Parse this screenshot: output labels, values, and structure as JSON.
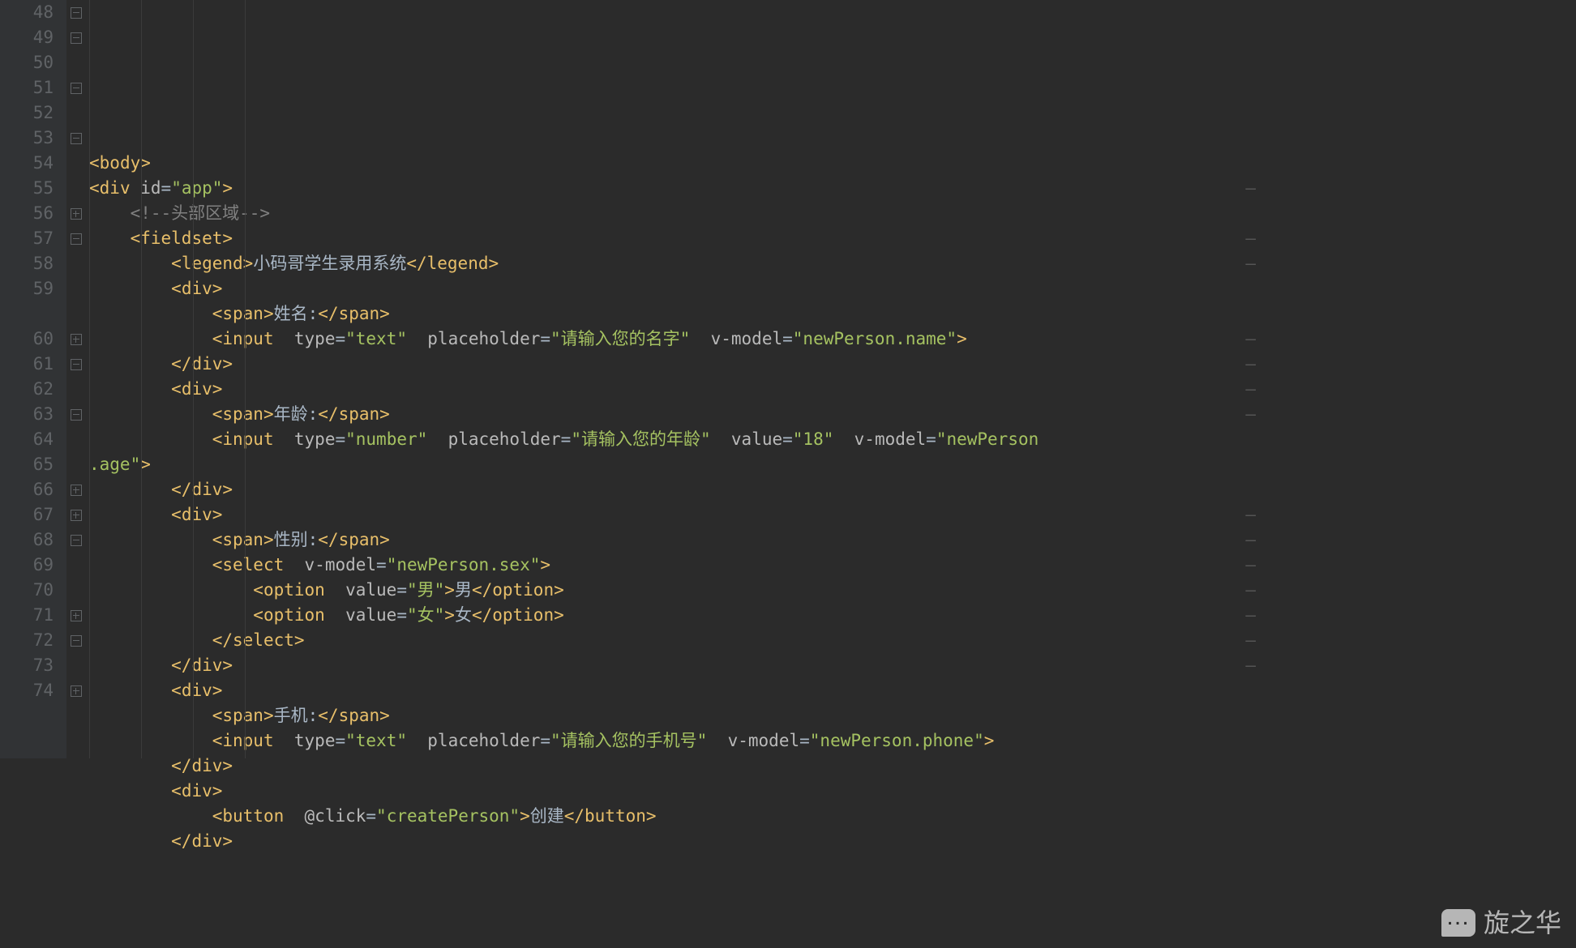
{
  "gutter": {
    "start": 48,
    "numbers": [
      "48",
      "49",
      "50",
      "51",
      "52",
      "53",
      "54",
      "55",
      "56",
      "57",
      "58",
      "59",
      "",
      "60",
      "61",
      "62",
      "63",
      "64",
      "65",
      "66",
      "67",
      "68",
      "69",
      "70",
      "71",
      "72",
      "73",
      "74"
    ]
  },
  "fold": [
    "open",
    "open",
    "blank",
    "open",
    "blank",
    "open",
    "blank",
    "blank",
    "close",
    "open",
    "blank",
    "blank",
    "blank",
    "close",
    "open",
    "blank",
    "open",
    "blank",
    "blank",
    "close",
    "close",
    "open",
    "blank",
    "blank",
    "close",
    "open",
    "blank",
    "close"
  ],
  "rows": [
    {
      "indent": 0,
      "parts": [
        {
          "t": "ang",
          "v": "<"
        },
        {
          "t": "tag",
          "v": "body"
        },
        {
          "t": "ang",
          "v": ">"
        }
      ]
    },
    {
      "indent": 0,
      "parts": [
        {
          "t": "ang",
          "v": "<"
        },
        {
          "t": "tag",
          "v": "div"
        },
        {
          "t": "txt",
          "v": " "
        },
        {
          "t": "attr",
          "v": "id"
        },
        {
          "t": "eq",
          "v": "="
        },
        {
          "t": "str",
          "v": "\"app\""
        },
        {
          "t": "ang",
          "v": ">"
        }
      ]
    },
    {
      "indent": 1,
      "parts": [
        {
          "t": "cmt",
          "v": "<!--头部区域-->"
        }
      ]
    },
    {
      "indent": 1,
      "parts": [
        {
          "t": "ang",
          "v": "<"
        },
        {
          "t": "tag",
          "v": "fieldset"
        },
        {
          "t": "ang",
          "v": ">"
        }
      ]
    },
    {
      "indent": 2,
      "parts": [
        {
          "t": "ang",
          "v": "<"
        },
        {
          "t": "tag",
          "v": "legend"
        },
        {
          "t": "ang",
          "v": ">"
        },
        {
          "t": "txt",
          "v": "小码哥学生录用系统"
        },
        {
          "t": "ang",
          "v": "</"
        },
        {
          "t": "tag",
          "v": "legend"
        },
        {
          "t": "ang",
          "v": ">"
        }
      ]
    },
    {
      "indent": 2,
      "parts": [
        {
          "t": "ang",
          "v": "<"
        },
        {
          "t": "tag",
          "v": "div"
        },
        {
          "t": "ang",
          "v": ">"
        }
      ]
    },
    {
      "indent": 3,
      "parts": [
        {
          "t": "ang",
          "v": "<"
        },
        {
          "t": "tag",
          "v": "span"
        },
        {
          "t": "ang",
          "v": ">"
        },
        {
          "t": "txt",
          "v": "姓名:"
        },
        {
          "t": "ang",
          "v": "</"
        },
        {
          "t": "tag",
          "v": "span"
        },
        {
          "t": "ang",
          "v": ">"
        }
      ]
    },
    {
      "indent": 3,
      "parts": [
        {
          "t": "ang",
          "v": "<"
        },
        {
          "t": "tag",
          "v": "input"
        },
        {
          "t": "txt",
          "v": "  "
        },
        {
          "t": "attr",
          "v": "type"
        },
        {
          "t": "eq",
          "v": "="
        },
        {
          "t": "str",
          "v": "\"text\""
        },
        {
          "t": "txt",
          "v": "  "
        },
        {
          "t": "attr",
          "v": "placeholder"
        },
        {
          "t": "eq",
          "v": "="
        },
        {
          "t": "str",
          "v": "\"请输入您的名字\""
        },
        {
          "t": "txt",
          "v": "  "
        },
        {
          "t": "attr",
          "v": "v-model"
        },
        {
          "t": "eq",
          "v": "="
        },
        {
          "t": "str",
          "v": "\"newPerson.name\""
        },
        {
          "t": "ang",
          "v": ">"
        }
      ]
    },
    {
      "indent": 2,
      "parts": [
        {
          "t": "ang",
          "v": "</"
        },
        {
          "t": "tag",
          "v": "div"
        },
        {
          "t": "ang",
          "v": ">"
        }
      ]
    },
    {
      "indent": 2,
      "parts": [
        {
          "t": "ang",
          "v": "<"
        },
        {
          "t": "tag",
          "v": "div"
        },
        {
          "t": "ang",
          "v": ">"
        }
      ]
    },
    {
      "indent": 3,
      "parts": [
        {
          "t": "ang",
          "v": "<"
        },
        {
          "t": "tag",
          "v": "span"
        },
        {
          "t": "ang",
          "v": ">"
        },
        {
          "t": "txt",
          "v": "年龄:"
        },
        {
          "t": "ang",
          "v": "</"
        },
        {
          "t": "tag",
          "v": "span"
        },
        {
          "t": "ang",
          "v": ">"
        }
      ]
    },
    {
      "indent": 3,
      "wrap": true,
      "parts": [
        {
          "t": "ang",
          "v": "<"
        },
        {
          "t": "tag",
          "v": "input"
        },
        {
          "t": "txt",
          "v": "  "
        },
        {
          "t": "attr",
          "v": "type"
        },
        {
          "t": "eq",
          "v": "="
        },
        {
          "t": "str",
          "v": "\"number\""
        },
        {
          "t": "txt",
          "v": "  "
        },
        {
          "t": "attr",
          "v": "placeholder"
        },
        {
          "t": "eq",
          "v": "="
        },
        {
          "t": "str",
          "v": "\"请输入您的年龄\""
        },
        {
          "t": "txt",
          "v": "  "
        },
        {
          "t": "attr",
          "v": "value"
        },
        {
          "t": "eq",
          "v": "="
        },
        {
          "t": "str",
          "v": "\"18\""
        },
        {
          "t": "txt",
          "v": "  "
        },
        {
          "t": "attr",
          "v": "v-model"
        },
        {
          "t": "eq",
          "v": "="
        },
        {
          "t": "str",
          "v": "\"newPerson"
        }
      ]
    },
    {
      "indent": 0,
      "parts": [
        {
          "t": "str",
          "v": ".age\""
        },
        {
          "t": "ang",
          "v": ">"
        }
      ]
    },
    {
      "indent": 2,
      "parts": [
        {
          "t": "ang",
          "v": "</"
        },
        {
          "t": "tag",
          "v": "div"
        },
        {
          "t": "ang",
          "v": ">"
        }
      ]
    },
    {
      "indent": 2,
      "parts": [
        {
          "t": "ang",
          "v": "<"
        },
        {
          "t": "tag",
          "v": "div"
        },
        {
          "t": "ang",
          "v": ">"
        }
      ]
    },
    {
      "indent": 3,
      "parts": [
        {
          "t": "ang",
          "v": "<"
        },
        {
          "t": "tag",
          "v": "span"
        },
        {
          "t": "ang",
          "v": ">"
        },
        {
          "t": "txt",
          "v": "性别:"
        },
        {
          "t": "ang",
          "v": "</"
        },
        {
          "t": "tag",
          "v": "span"
        },
        {
          "t": "ang",
          "v": ">"
        }
      ]
    },
    {
      "indent": 3,
      "parts": [
        {
          "t": "ang",
          "v": "<"
        },
        {
          "t": "tag",
          "v": "select"
        },
        {
          "t": "txt",
          "v": "  "
        },
        {
          "t": "attr",
          "v": "v-model"
        },
        {
          "t": "eq",
          "v": "="
        },
        {
          "t": "str",
          "v": "\"newPerson.sex\""
        },
        {
          "t": "ang",
          "v": ">"
        }
      ]
    },
    {
      "indent": 4,
      "parts": [
        {
          "t": "ang",
          "v": "<"
        },
        {
          "t": "tag",
          "v": "option"
        },
        {
          "t": "txt",
          "v": "  "
        },
        {
          "t": "attr",
          "v": "value"
        },
        {
          "t": "eq",
          "v": "="
        },
        {
          "t": "str",
          "v": "\"男\""
        },
        {
          "t": "ang",
          "v": ">"
        },
        {
          "t": "txt",
          "v": "男"
        },
        {
          "t": "ang",
          "v": "</"
        },
        {
          "t": "tag",
          "v": "option"
        },
        {
          "t": "ang",
          "v": ">"
        }
      ]
    },
    {
      "indent": 4,
      "parts": [
        {
          "t": "ang",
          "v": "<"
        },
        {
          "t": "tag",
          "v": "option"
        },
        {
          "t": "txt",
          "v": "  "
        },
        {
          "t": "attr",
          "v": "value"
        },
        {
          "t": "eq",
          "v": "="
        },
        {
          "t": "str",
          "v": "\"女\""
        },
        {
          "t": "ang",
          "v": ">"
        },
        {
          "t": "txt",
          "v": "女"
        },
        {
          "t": "ang",
          "v": "</"
        },
        {
          "t": "tag",
          "v": "option"
        },
        {
          "t": "ang",
          "v": ">"
        }
      ]
    },
    {
      "indent": 3,
      "parts": [
        {
          "t": "ang",
          "v": "</"
        },
        {
          "t": "tag",
          "v": "select"
        },
        {
          "t": "ang",
          "v": ">"
        }
      ]
    },
    {
      "indent": 2,
      "parts": [
        {
          "t": "ang",
          "v": "</"
        },
        {
          "t": "tag",
          "v": "div"
        },
        {
          "t": "ang",
          "v": ">"
        }
      ]
    },
    {
      "indent": 2,
      "parts": [
        {
          "t": "ang",
          "v": "<"
        },
        {
          "t": "tag",
          "v": "div"
        },
        {
          "t": "ang",
          "v": ">"
        }
      ]
    },
    {
      "indent": 3,
      "parts": [
        {
          "t": "ang",
          "v": "<"
        },
        {
          "t": "tag",
          "v": "span"
        },
        {
          "t": "ang",
          "v": ">"
        },
        {
          "t": "txt",
          "v": "手机:"
        },
        {
          "t": "ang",
          "v": "</"
        },
        {
          "t": "tag",
          "v": "span"
        },
        {
          "t": "ang",
          "v": ">"
        }
      ]
    },
    {
      "indent": 3,
      "parts": [
        {
          "t": "ang",
          "v": "<"
        },
        {
          "t": "tag",
          "v": "input"
        },
        {
          "t": "txt",
          "v": "  "
        },
        {
          "t": "attr",
          "v": "type"
        },
        {
          "t": "eq",
          "v": "="
        },
        {
          "t": "str",
          "v": "\"text\""
        },
        {
          "t": "txt",
          "v": "  "
        },
        {
          "t": "attr",
          "v": "placeholder"
        },
        {
          "t": "eq",
          "v": "="
        },
        {
          "t": "str",
          "v": "\"请输入您的手机号\""
        },
        {
          "t": "txt",
          "v": "  "
        },
        {
          "t": "attr",
          "v": "v-model"
        },
        {
          "t": "eq",
          "v": "="
        },
        {
          "t": "str",
          "v": "\"newPerson.phone\""
        },
        {
          "t": "ang",
          "v": ">"
        }
      ]
    },
    {
      "indent": 2,
      "parts": [
        {
          "t": "ang",
          "v": "</"
        },
        {
          "t": "tag",
          "v": "div"
        },
        {
          "t": "ang",
          "v": ">"
        }
      ]
    },
    {
      "indent": 2,
      "parts": [
        {
          "t": "ang",
          "v": "<"
        },
        {
          "t": "tag",
          "v": "div"
        },
        {
          "t": "ang",
          "v": ">"
        }
      ]
    },
    {
      "indent": 3,
      "parts": [
        {
          "t": "ang",
          "v": "<"
        },
        {
          "t": "tag",
          "v": "button"
        },
        {
          "t": "txt",
          "v": "  "
        },
        {
          "t": "attr",
          "v": "@click"
        },
        {
          "t": "eq",
          "v": "="
        },
        {
          "t": "str",
          "v": "\"createPerson\""
        },
        {
          "t": "ang",
          "v": ">"
        },
        {
          "t": "txt",
          "v": "创建"
        },
        {
          "t": "ang",
          "v": "</"
        },
        {
          "t": "tag",
          "v": "button"
        },
        {
          "t": "ang",
          "v": ">"
        }
      ]
    },
    {
      "indent": 2,
      "parts": [
        {
          "t": "ang",
          "v": "</"
        },
        {
          "t": "tag",
          "v": "div"
        },
        {
          "t": "ang",
          "v": ">"
        }
      ]
    }
  ],
  "watermark": "旋之华",
  "softdash_rows": [
    7,
    9,
    10,
    13,
    14,
    15,
    16,
    20,
    21,
    22,
    23,
    24,
    25,
    26
  ]
}
